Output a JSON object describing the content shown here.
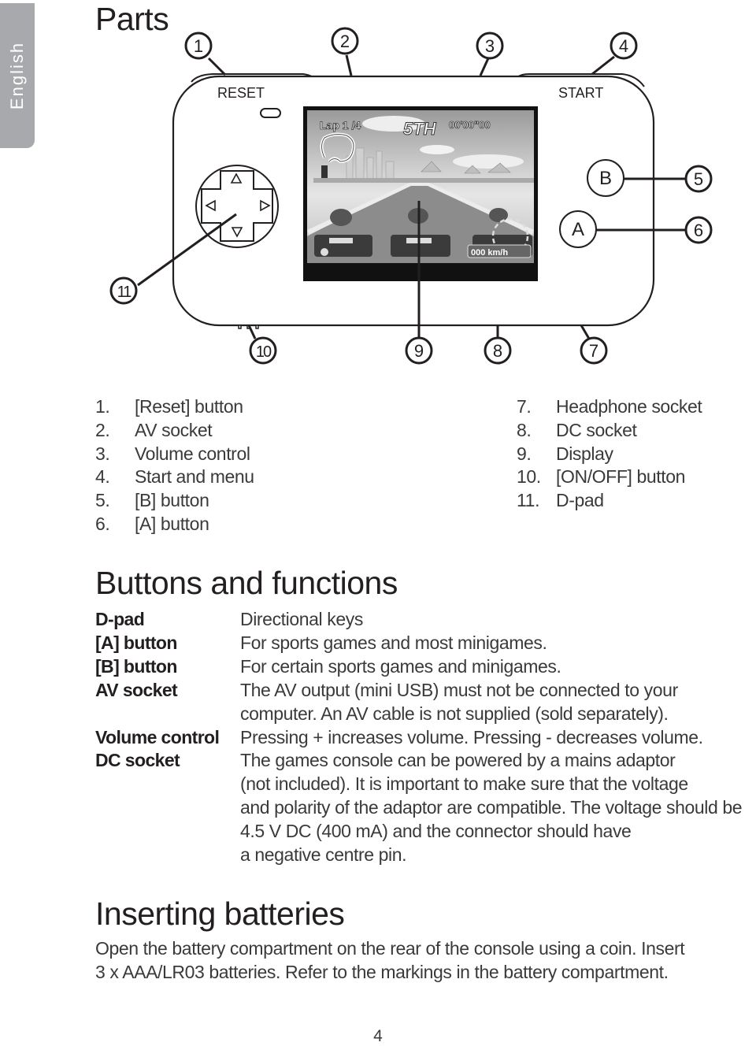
{
  "language_tab": "English",
  "sections": {
    "parts_title": "Parts",
    "buttons_title": "Buttons and functions",
    "batteries_title": "Inserting batteries"
  },
  "diagram": {
    "reset_label": "RESET",
    "start_label": "START",
    "button_b_label": "B",
    "button_a_label": "A",
    "screen_hud": {
      "lap": "Lap 1 /4",
      "position": "5TH",
      "time": "00'00\"00",
      "speed": "000 km/h"
    },
    "callouts": [
      "1",
      "2",
      "3",
      "4",
      "5",
      "6",
      "7",
      "8",
      "9",
      "10",
      "11"
    ]
  },
  "parts_list": {
    "left": [
      {
        "num": "1.",
        "label": "[Reset] button"
      },
      {
        "num": "2.",
        "label": "AV socket"
      },
      {
        "num": "3.",
        "label": "Volume control"
      },
      {
        "num": "4.",
        "label": "Start and menu"
      },
      {
        "num": "5.",
        "label": "[B] button"
      },
      {
        "num": "6.",
        "label": "[A] button"
      }
    ],
    "right": [
      {
        "num": "7.",
        "label": "Headphone socket"
      },
      {
        "num": "8.",
        "label": "DC socket"
      },
      {
        "num": "9.",
        "label": "Display"
      },
      {
        "num": "10.",
        "label": "[ON/OFF] button"
      },
      {
        "num": "11.",
        "label": "D-pad"
      }
    ]
  },
  "buttons_functions": [
    {
      "term": "D-pad",
      "lines": [
        "Directional keys"
      ]
    },
    {
      "term": "[A] button",
      "lines": [
        "For sports games and most minigames."
      ]
    },
    {
      "term": "[B] button",
      "lines": [
        "For certain sports games and minigames."
      ]
    },
    {
      "term": "AV socket",
      "lines": [
        "The AV output (mini USB) must not be connected to your",
        "computer. An AV cable is not supplied (sold separately)."
      ]
    },
    {
      "term": "Volume control",
      "lines": [
        "Pressing + increases volume. Pressing - decreases volume."
      ]
    },
    {
      "term": "DC socket",
      "lines": [
        "The games console can be powered by a mains adaptor",
        "(not included). It is important to make sure that the voltage",
        "and polarity of the adaptor are compatible. The voltage should be",
        "4.5 V DC (400 mA) and the connector should have",
        "a negative centre pin."
      ]
    }
  ],
  "batteries_text": [
    "Open the battery compartment on the rear of the console using a coin. Insert",
    "3 x AAA/LR03 batteries. Refer to the markings in the battery compartment."
  ],
  "page_number": "4"
}
